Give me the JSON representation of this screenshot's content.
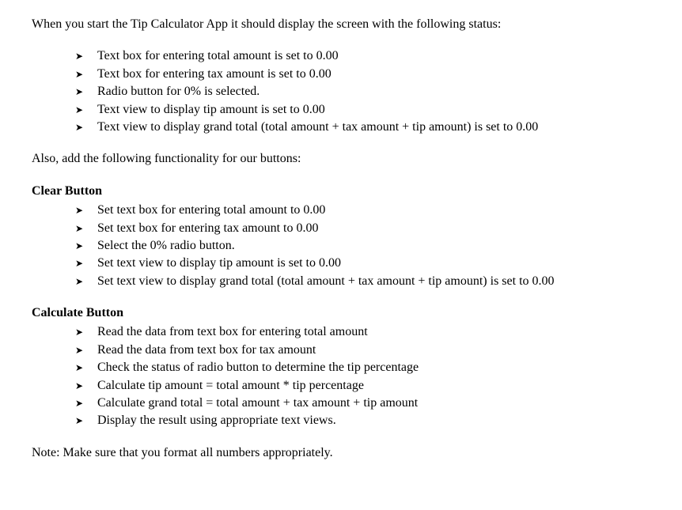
{
  "intro": "When you start the Tip Calculator App it should display the screen with the following status:",
  "intro_bullets": [
    "Text box for entering total amount is set to 0.00",
    "Text box for entering tax amount is set to 0.00",
    "Radio button for 0% is selected.",
    "Text view to display tip amount is set to 0.00",
    "Text view to display grand total (total amount + tax amount + tip amount) is set to 0.00"
  ],
  "also": "Also, add the following functionality for our buttons:",
  "clear_heading": "Clear Button",
  "clear_bullets": [
    "Set text box for entering total amount to 0.00",
    "Set text box for entering tax amount to 0.00",
    "Select the 0% radio button.",
    "Set text view to display tip amount is set to 0.00",
    "Set text view to display grand total (total amount + tax amount + tip amount) is set to 0.00"
  ],
  "calculate_heading": "Calculate Button",
  "calculate_bullets": [
    "Read the data from text box for entering total amount",
    "Read the data from text box for tax amount",
    "Check the status of radio button to determine the tip percentage",
    "Calculate tip amount = total amount * tip percentage",
    "Calculate grand total = total amount + tax amount + tip amount",
    "Display the result using appropriate text views."
  ],
  "note": "Note: Make sure that you format all numbers appropriately."
}
